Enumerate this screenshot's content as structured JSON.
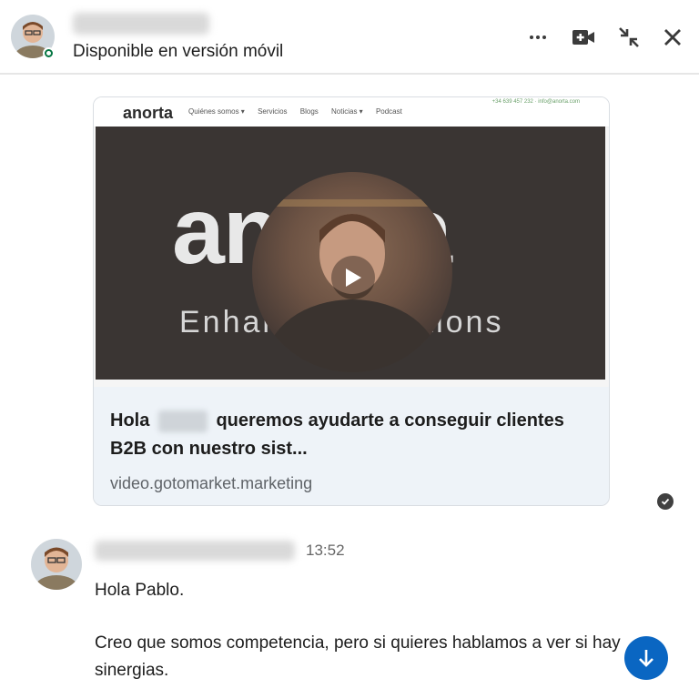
{
  "header": {
    "status_text": "Disponible en versión móvil",
    "icons": [
      "more-icon",
      "video-call-icon",
      "minimize-icon",
      "close-icon"
    ]
  },
  "link_card": {
    "thumbnail": {
      "logo_text": "anorta",
      "nav_items": [
        "Quiénes somos ▾",
        "Servicios",
        "Blogs",
        "Noticias ▾",
        "Podcast"
      ],
      "contact_text": "+34 639 457 232 · info@anorta.com",
      "big_word": "anorta",
      "tagline": "Enhanced Solutions"
    },
    "title_before": "Hola",
    "title_after": "queremos ayudarte a conseguir clientes B2B con nuestro sist...",
    "domain": "video.gotomarket.marketing"
  },
  "message": {
    "time": "13:52",
    "lines": [
      "Hola Pablo.",
      "Creo que somos competencia, pero si quieres hablamos a ver si hay sinergias."
    ]
  },
  "colors": {
    "accent": "#0a66c2",
    "presence": "#057642",
    "card_bg": "#eef3f8"
  }
}
